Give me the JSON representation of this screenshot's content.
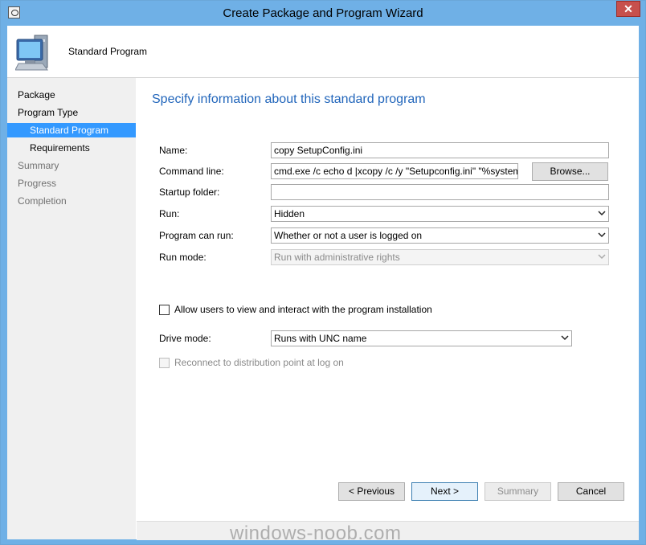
{
  "window": {
    "title": "Create Package and Program Wizard",
    "close_label": "✕"
  },
  "header": {
    "title": "Standard Program",
    "icon": "computer-icon"
  },
  "nav": {
    "items": [
      {
        "label": "Package",
        "state": "normal"
      },
      {
        "label": "Program Type",
        "state": "normal"
      },
      {
        "label": "Standard Program",
        "state": "selected"
      },
      {
        "label": "Requirements",
        "state": "normal"
      },
      {
        "label": "Summary",
        "state": "dim"
      },
      {
        "label": "Progress",
        "state": "dim"
      },
      {
        "label": "Completion",
        "state": "dim"
      }
    ]
  },
  "main": {
    "heading": "Specify information about this standard program",
    "name_label": "Name:",
    "name_value": "copy SetupConfig.ini",
    "command_label": "Command line:",
    "command_value": "cmd.exe /c echo d |xcopy /c /y \"Setupconfig.ini\" \"%systemdriv",
    "browse_label": "Browse...",
    "startup_label": "Startup folder:",
    "startup_value": "",
    "run_label": "Run:",
    "run_value": "Hidden",
    "program_can_run_label": "Program can run:",
    "program_can_run_value": "Whether or not a user is logged on",
    "run_mode_label": "Run mode:",
    "run_mode_value": "Run with administrative rights",
    "allow_users_label": "Allow users to view and interact with the program installation",
    "drive_mode_label": "Drive mode:",
    "drive_mode_value": "Runs with UNC name",
    "reconnect_label": "Reconnect to distribution point at log on"
  },
  "buttons": {
    "previous": "< Previous",
    "next": "Next >",
    "summary": "Summary",
    "cancel": "Cancel"
  },
  "watermark": "windows-noob.com",
  "colors": {
    "titlebar": "#6fb0e6",
    "selected_nav": "#3399ff",
    "heading": "#2266bb",
    "close": "#c7504c"
  }
}
